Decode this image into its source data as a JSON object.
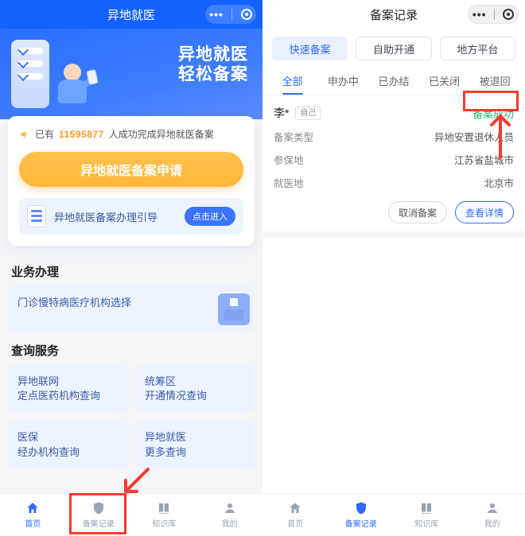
{
  "left": {
    "title": "异地就医",
    "hero": {
      "line1": "异地就医",
      "line2": "轻松备案"
    },
    "counter": {
      "prefix": "已有",
      "number": "11595877",
      "suffix": "人成功完成异地就医备案"
    },
    "apply_btn": "异地就医备案申请",
    "guide": {
      "text": "异地就医备案办理引导",
      "enter": "点击进入"
    },
    "biz_title": "业务办理",
    "biz_tile": "门诊慢特病医疗机构选择",
    "query_title": "查询服务",
    "tiles": {
      "a1": "异地联网",
      "a2": "定点医药机构查询",
      "b1": "统筹区",
      "b2": "开通情况查询",
      "c1": "医保",
      "c2": "经办机构查询",
      "d1": "异地就医",
      "d2": "更多查询"
    },
    "tabs": {
      "home": "首页",
      "record": "备案记录",
      "kb": "知识库",
      "mine": "我的"
    }
  },
  "right": {
    "title": "备案记录",
    "segs": {
      "quick": "快速备案",
      "self": "自助开通",
      "local": "地方平台"
    },
    "filters": {
      "all": "全部",
      "pending": "申办中",
      "done": "已办结",
      "closed": "已关闭",
      "returned": "被退回"
    },
    "rec": {
      "name": "李*",
      "self_tag": "自己",
      "status": "备案成功",
      "type_k": "备案类型",
      "type_v": "异地安置退休人员",
      "insure_k": "参保地",
      "insure_v": "江苏省盐城市",
      "treat_k": "就医地",
      "treat_v": "北京市",
      "cancel": "取消备案",
      "detail": "查看详情"
    },
    "tabs": {
      "home": "首页",
      "record": "备案记录",
      "kb": "知识库",
      "mine": "我的"
    }
  }
}
